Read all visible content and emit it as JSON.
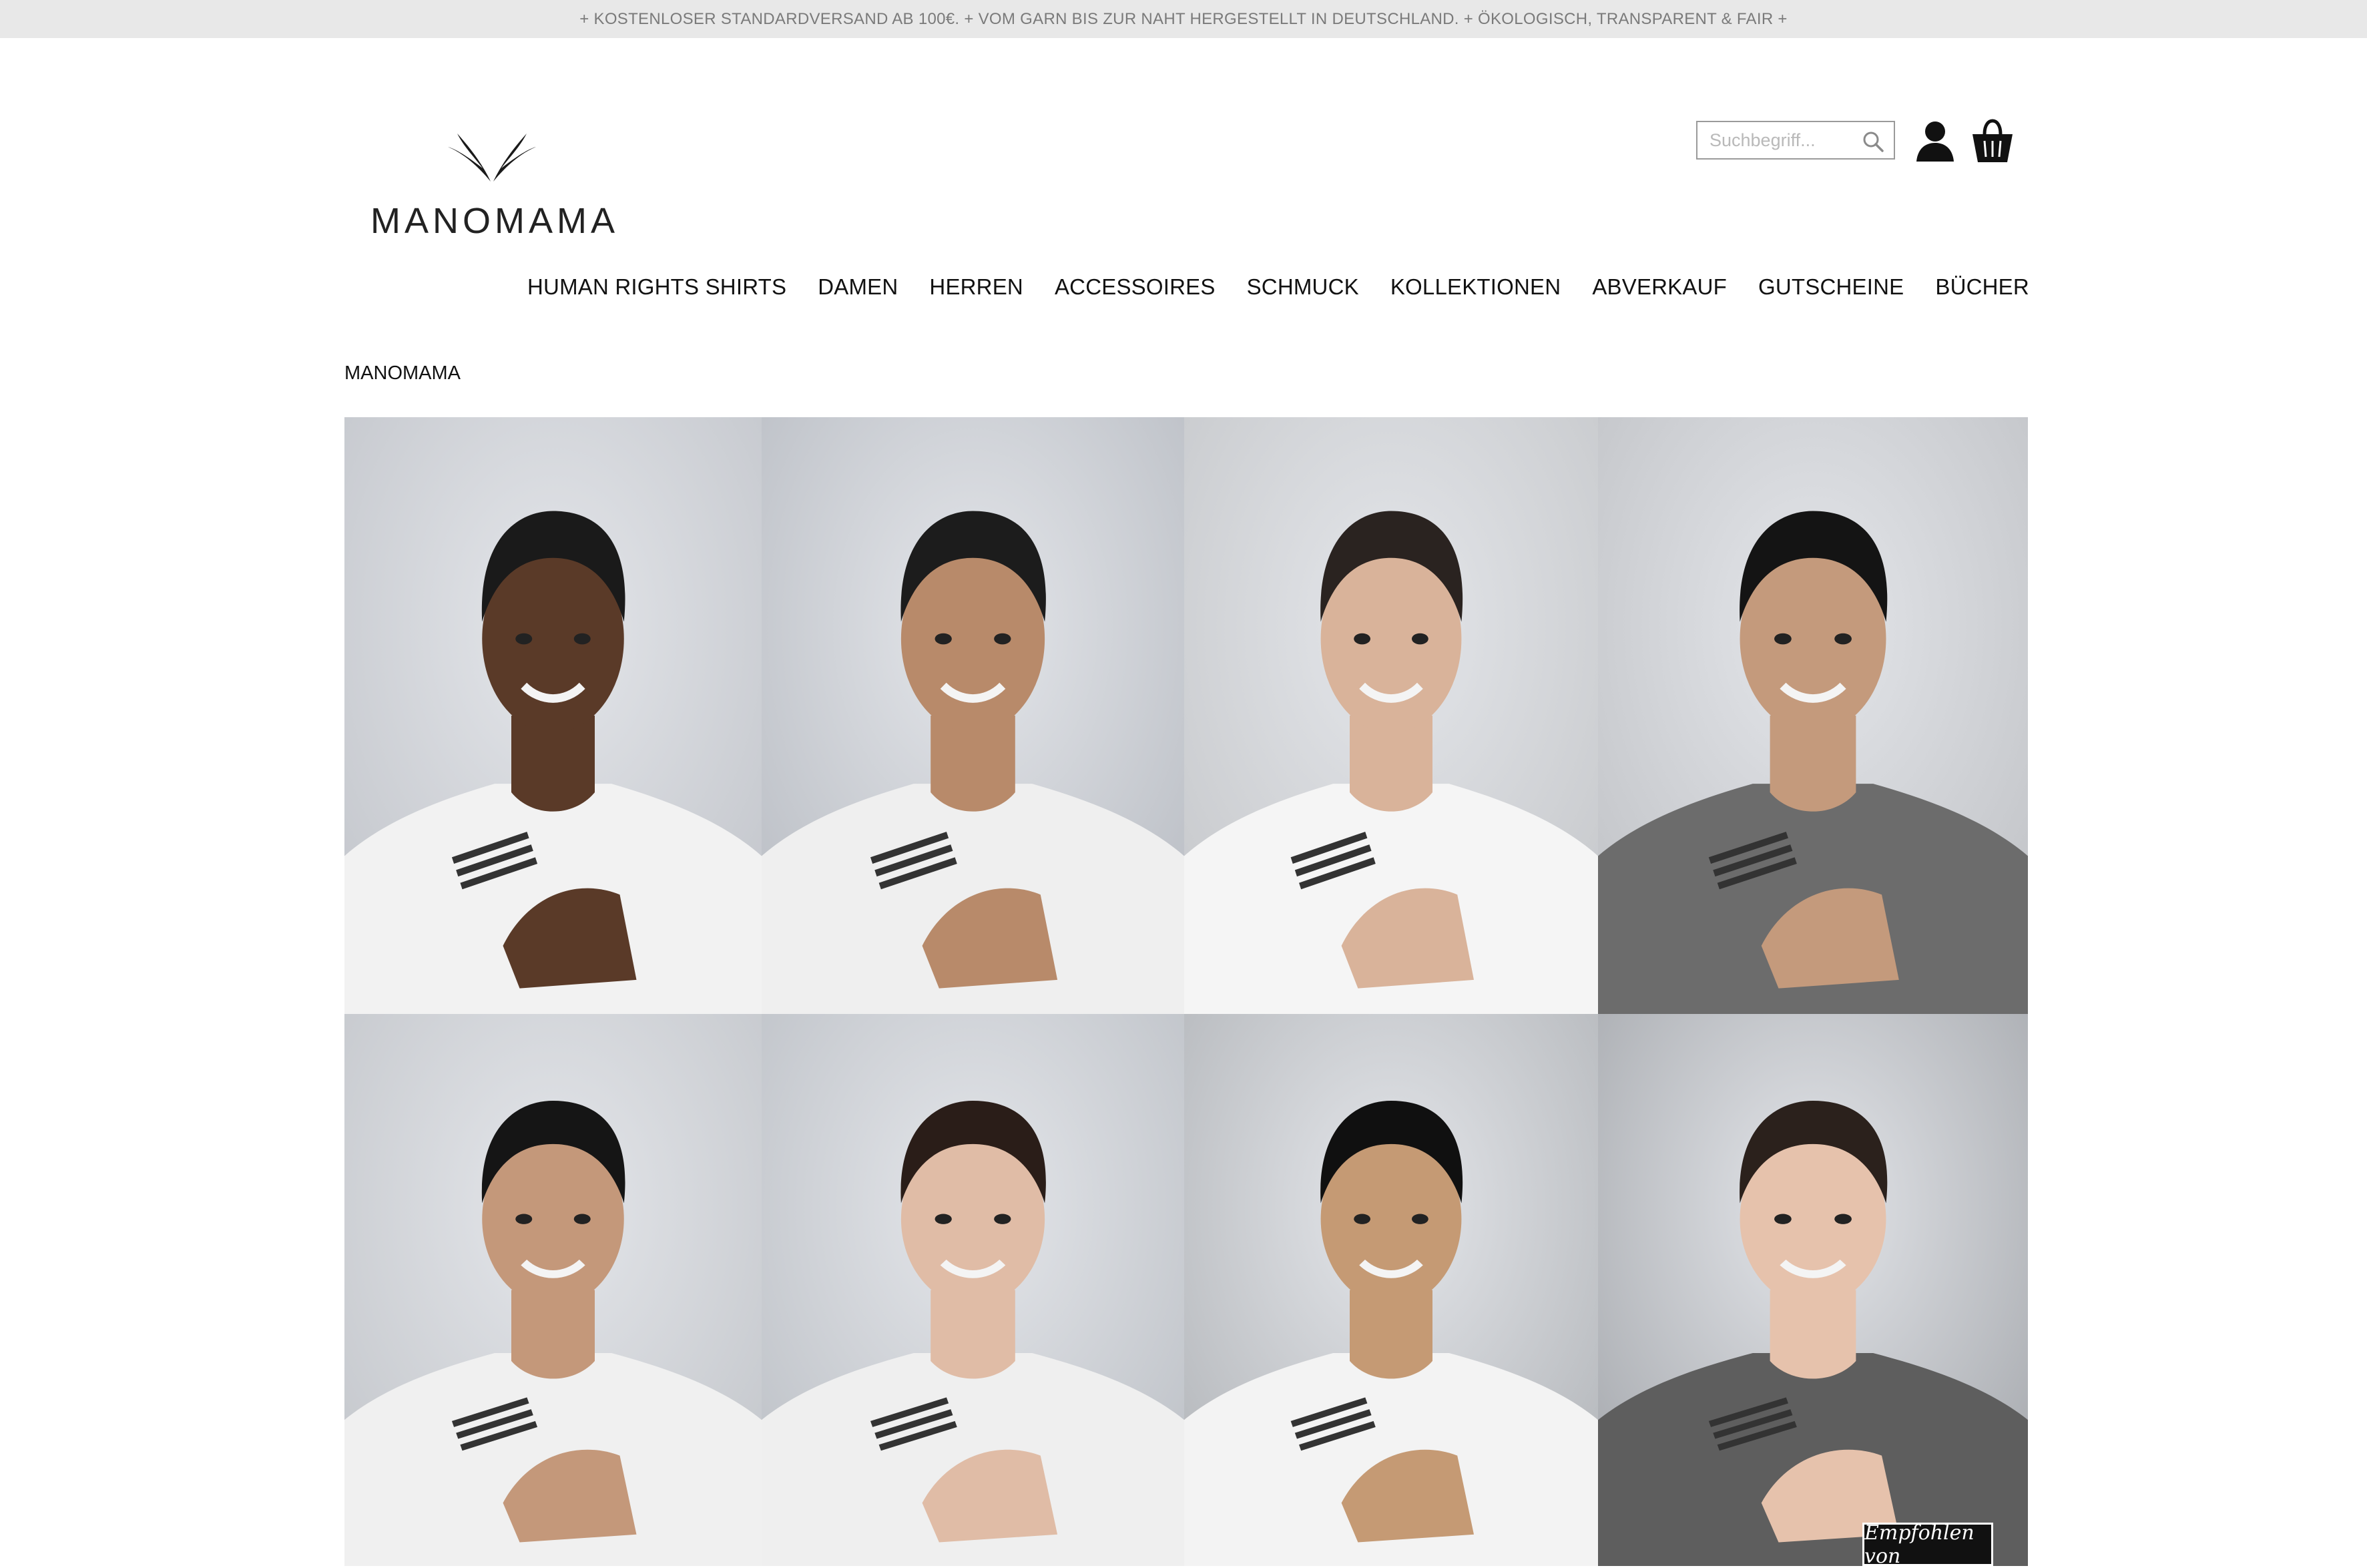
{
  "top_bar": {
    "text": "+ KOSTENLOSER STANDARDVERSAND AB 100€. + VOM GARN BIS ZUR NAHT HERGESTELLT IN DEUTSCHLAND. + ÖKOLOGISCH, TRANSPARENT & FAIR +"
  },
  "header": {
    "logo_text": "MANOMAMA",
    "search": {
      "placeholder": "Suchbegriff...",
      "value": ""
    },
    "icons": [
      "search-icon",
      "account-icon",
      "cart-icon"
    ]
  },
  "nav": {
    "items": [
      {
        "label": "HUMAN RIGHTS SHIRTS"
      },
      {
        "label": "DAMEN"
      },
      {
        "label": "HERREN"
      },
      {
        "label": "ACCESSOIRES"
      },
      {
        "label": "SCHMUCK"
      },
      {
        "label": "KOLLEKTIONEN"
      },
      {
        "label": "ABVERKAUF"
      },
      {
        "label": "GUTSCHEINE"
      },
      {
        "label": "BÜCHER"
      }
    ]
  },
  "breadcrumb": {
    "current": "MANOMAMA"
  },
  "hero": {
    "portraits": [
      {
        "shirt": "#f2f2f2",
        "skin": "#5a3a28",
        "hair": "#1a1a1a",
        "bg": "#bfc2c8"
      },
      {
        "shirt": "#efefef",
        "skin": "#b88a6a",
        "hair": "#1c1c1c",
        "bg": "#b5b9c0"
      },
      {
        "shirt": "#f5f5f5",
        "skin": "#d9b39a",
        "hair": "#2a2320",
        "bg": "#c3c5c8"
      },
      {
        "shirt": "#6c6c6c",
        "skin": "#c49a7c",
        "hair": "#141414",
        "bg": "#bdbfc3"
      },
      {
        "shirt": "#f0f0f0",
        "skin": "#c4987a",
        "hair": "#151515",
        "bg": "#c0c3c8"
      },
      {
        "shirt": "#efefef",
        "skin": "#e0bca6",
        "hair": "#2a1d18",
        "bg": "#b9bdc3"
      },
      {
        "shirt": "#f3f3f3",
        "skin": "#c59a74",
        "hair": "#101010",
        "bg": "#aeb1b5"
      },
      {
        "shirt": "#5e5e5e",
        "skin": "#e6c2ac",
        "hair": "#2b211c",
        "bg": "#9fa2a7"
      }
    ]
  },
  "badge": {
    "label": "Empfohlen von"
  }
}
